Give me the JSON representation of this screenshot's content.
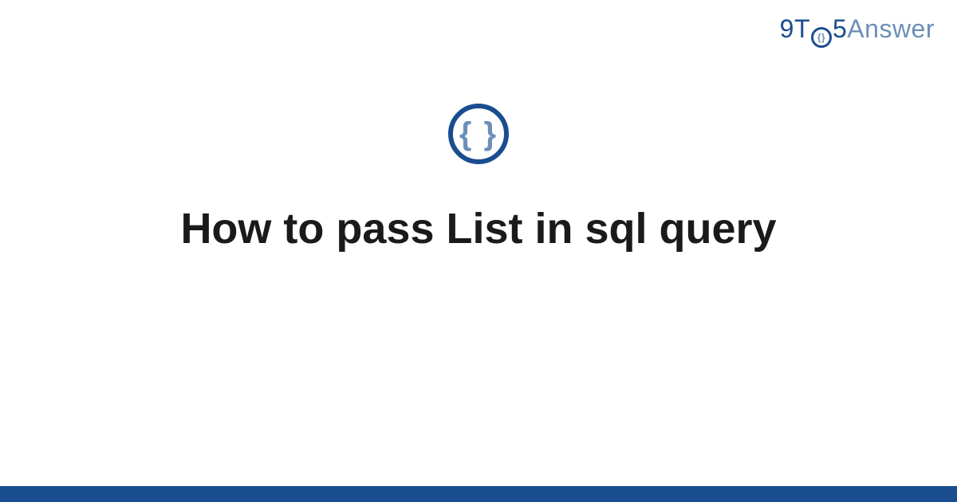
{
  "logo": {
    "part1": "9T",
    "o_inner": "{}",
    "part2": "5",
    "part3": "Answer"
  },
  "icon": {
    "braces": "{ }"
  },
  "title": "How to pass List in sql query",
  "colors": {
    "primary": "#1a4d8f",
    "secondary": "#6c8fb8",
    "text": "#1a1a1a"
  }
}
